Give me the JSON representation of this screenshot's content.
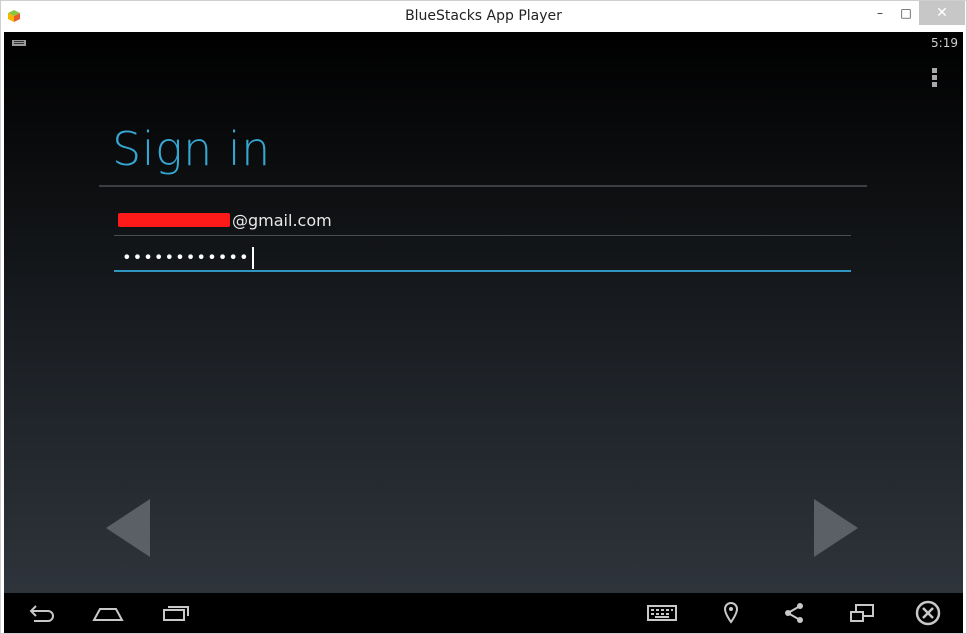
{
  "window": {
    "title": "BlueStacks App Player",
    "controls": {
      "minimize": "–",
      "maximize": "□",
      "close": "✕"
    }
  },
  "status_bar": {
    "time": "5:19"
  },
  "sign_in": {
    "heading": "Sign in",
    "email_domain": "@gmail.com",
    "password_masked": "••••••••••••"
  },
  "icons": {
    "app": "bluestacks-logo-icon",
    "status": "keyboard-status-icon",
    "menu": "overflow-menu-icon",
    "prev": "triangle-left-icon",
    "next": "triangle-right-icon",
    "back": "back-icon",
    "home": "home-icon",
    "recent": "recent-apps-icon",
    "keyboard": "keyboard-icon",
    "location": "location-pin-icon",
    "share": "share-icon",
    "multiwindow": "multi-window-icon",
    "close": "close-circle-icon"
  },
  "colors": {
    "accent": "#35a7d3",
    "focus_underline": "#2f96c2",
    "redaction": "#ff1a1a"
  }
}
